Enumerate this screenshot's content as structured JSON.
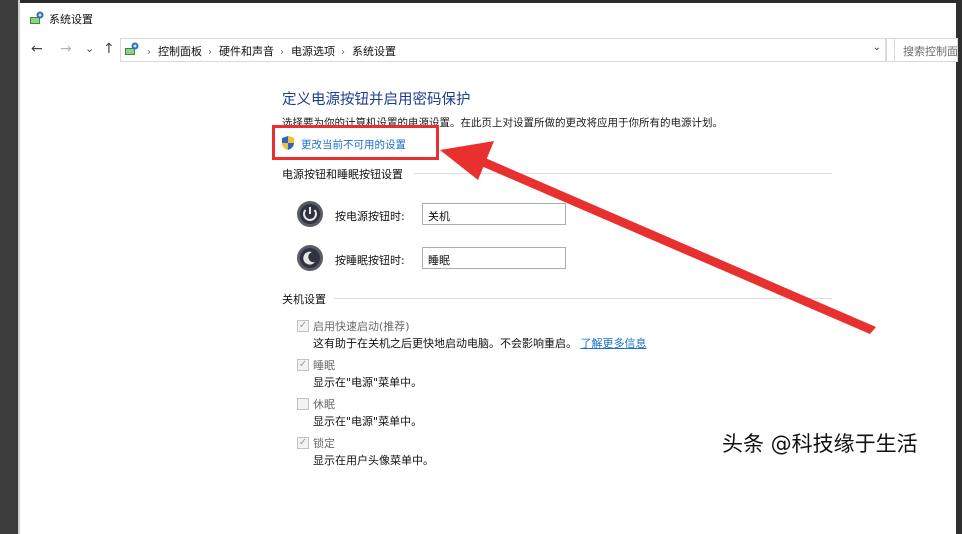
{
  "window": {
    "title": "系统设置"
  },
  "nav": {
    "back": "←",
    "forward": "→",
    "recent": "⌄",
    "up": "↑"
  },
  "address": {
    "crumbs": [
      "控制面板",
      "硬件和声音",
      "电源选项",
      "系统设置"
    ],
    "search_placeholder": "搜索控制面"
  },
  "page": {
    "heading": "定义电源按钮并启用密码保护",
    "description": "选择要为你的计算机设置的电源设置。在此页上对设置所做的更改将应用于你所有的电源计划。",
    "change_link": "更改当前不可用的设置",
    "buttons_section": {
      "title": "电源按钮和睡眠按钮设置",
      "power_label": "按电源按钮时:",
      "power_value": "关机",
      "sleep_label": "按睡眠按钮时:",
      "sleep_value": "睡眠"
    },
    "shutdown_section": {
      "title": "关机设置",
      "items": [
        {
          "label": "启用快速启动(推荐)",
          "checked": true,
          "desc": "这有助于在关机之后更快地启动电脑。不会影响重启。",
          "link": "了解更多信息"
        },
        {
          "label": "睡眠",
          "checked": true,
          "desc": "显示在\"电源\"菜单中。"
        },
        {
          "label": "休眠",
          "checked": false,
          "desc": "显示在\"电源\"菜单中。"
        },
        {
          "label": "锁定",
          "checked": true,
          "desc": "显示在用户头像菜单中。"
        }
      ]
    }
  },
  "watermark": "头条 @科技缘于生活",
  "colors": {
    "heading": "#1e3d8f",
    "link": "#1c6ec7",
    "annotation": "#e8312f"
  }
}
